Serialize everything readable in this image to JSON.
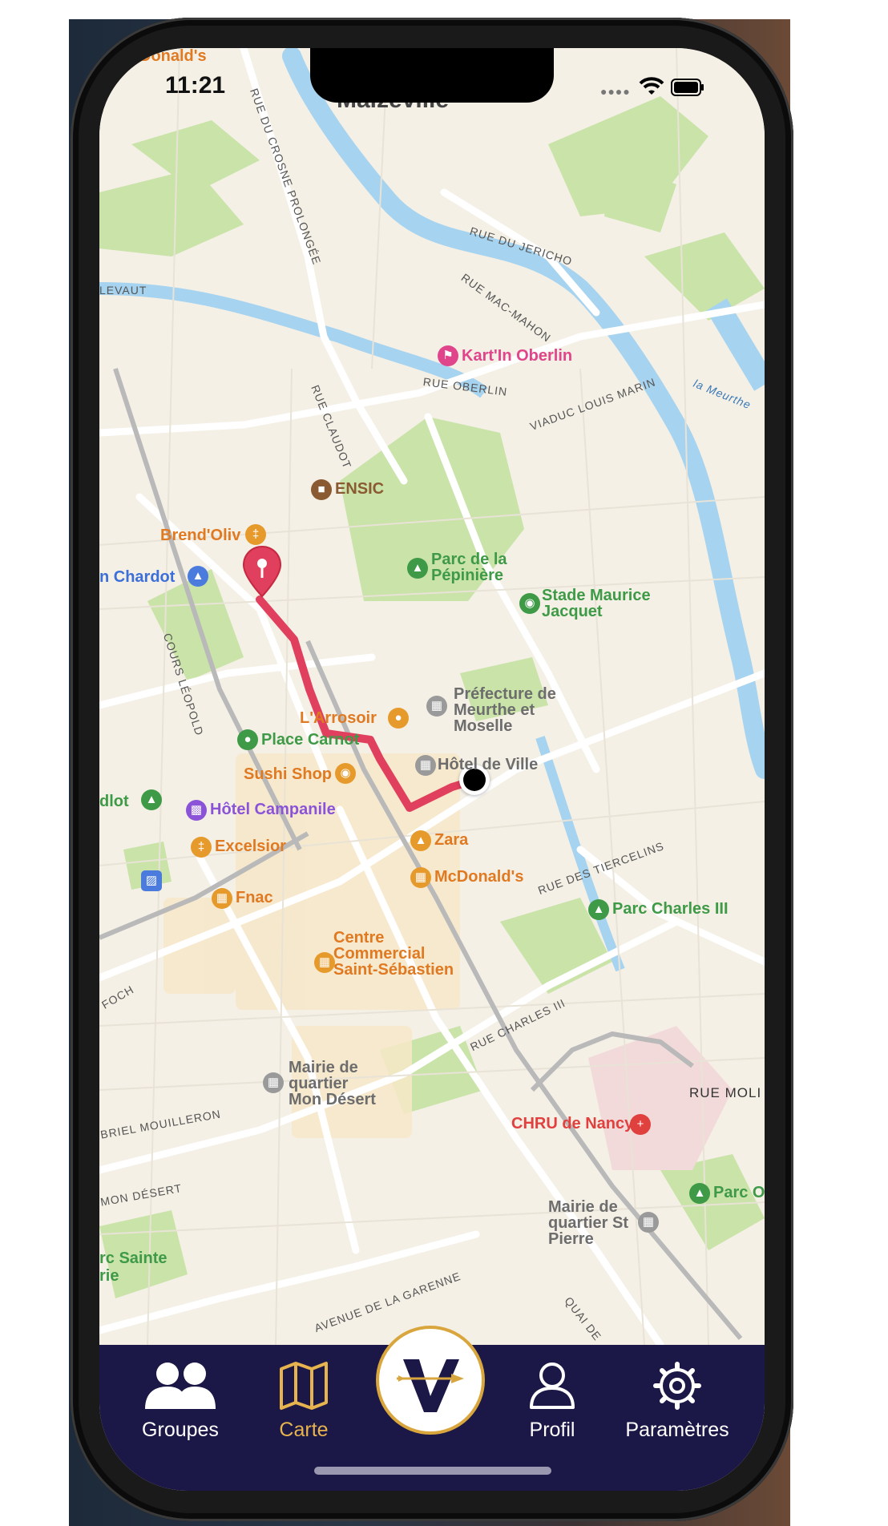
{
  "status_bar": {
    "time": "11:21"
  },
  "map": {
    "district_label": "Malzéville",
    "streets": [
      "RUE DU CROSNE PROLONGÉE",
      "RUE DU JERICHO",
      "RUE MAC-MAHON",
      "LEVAUT",
      "RUE OBERLIN",
      "RUE CLAUDOT",
      "VIADUC LOUIS MARIN",
      "la Meurthe",
      "COURS LÉOPOLD",
      "RUE DES TIERCELINS",
      "RUE CHARLES III",
      "RUE MOLI",
      "FOCH",
      "BRIEL MOUILLERON",
      "MON DÉSERT",
      "AVENUE DE LA GARENNE",
      "QUAI DE"
    ],
    "pois": [
      {
        "name": "Donald's",
        "category": "restaurant"
      },
      {
        "name": "Kart'In Oberlin",
        "category": "leisure"
      },
      {
        "name": "ENSIC",
        "category": "education"
      },
      {
        "name": "Brend'Oliv",
        "category": "restaurant"
      },
      {
        "name": "n Chardot",
        "category": "museum"
      },
      {
        "name": "Parc de la Pépinière",
        "category": "park"
      },
      {
        "name": "Stade Maurice Jacquet",
        "category": "stadium"
      },
      {
        "name": "Préfecture de Meurthe et Moselle",
        "category": "government"
      },
      {
        "name": "L'Arrosoir",
        "category": "restaurant"
      },
      {
        "name": "Place Carnot",
        "category": "park"
      },
      {
        "name": "Hôtel de Ville",
        "category": "government"
      },
      {
        "name": "Sushi Shop",
        "category": "restaurant"
      },
      {
        "name": "dlot",
        "category": "park"
      },
      {
        "name": "Hôtel Campanile",
        "category": "hotel"
      },
      {
        "name": "Excelsior",
        "category": "restaurant"
      },
      {
        "name": "Zara",
        "category": "shopping"
      },
      {
        "name": "McDonald's",
        "category": "restaurant"
      },
      {
        "name": "Fnac",
        "category": "shopping"
      },
      {
        "name": "Parc Charles III",
        "category": "park"
      },
      {
        "name": "Centre Commercial Saint-Sébastien",
        "category": "shopping"
      },
      {
        "name": "Mairie de quartier Mon Désert",
        "category": "government"
      },
      {
        "name": "CHRU de Nancy",
        "category": "hospital"
      },
      {
        "name": "Parc O",
        "category": "park"
      },
      {
        "name": "Mairie de quartier St Pierre",
        "category": "government"
      },
      {
        "name": "rc Sainte",
        "category": "park"
      },
      {
        "name": "rie",
        "category": "park"
      }
    ],
    "route": {
      "color": "#e0405e",
      "from": "current-location",
      "to": "destination-pin"
    }
  },
  "tabbar": {
    "items": [
      {
        "label": "Groupes",
        "icon": "groups-icon",
        "active": false
      },
      {
        "label": "Carte",
        "icon": "map-icon",
        "active": true
      },
      {
        "label": "Profil",
        "icon": "profile-icon",
        "active": false
      },
      {
        "label": "Paramètres",
        "icon": "settings-gear-icon",
        "active": false
      }
    ],
    "center_button": {
      "icon": "app-logo-v-icon"
    },
    "active_color": "#e6b34e",
    "background": "#1b1746"
  }
}
